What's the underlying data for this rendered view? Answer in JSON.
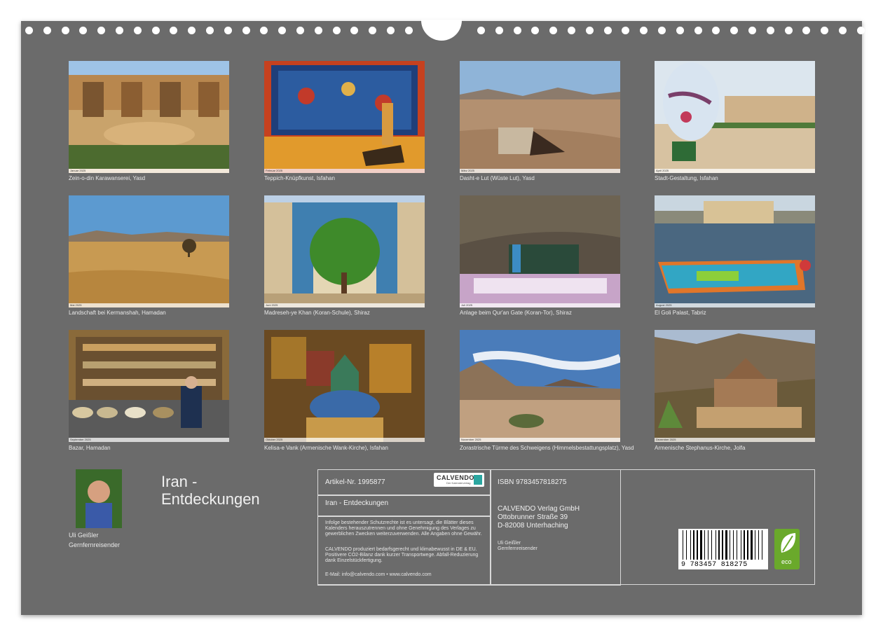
{
  "photos": [
    {
      "month": "Januar 2025",
      "caption": "Zein-o-din Karawanserei, Yasd"
    },
    {
      "month": "Februar 2025",
      "caption": "Teppich-Knüpfkunst, Isfahan"
    },
    {
      "month": "März 2025",
      "caption": "Dasht-e Lut (Wüste Lut), Yasd"
    },
    {
      "month": "April 2025",
      "caption": "Stadt-Gestaltung, Isfahan"
    },
    {
      "month": "Mai 2025",
      "caption": "Landschaft bei Kermanshah, Hamadan"
    },
    {
      "month": "Juni 2025",
      "caption": "Madreseh-ye Khan (Koran-Schule), Shiraz"
    },
    {
      "month": "Juli 2025",
      "caption": "Anlage beim Qur'an Gate (Koran-Tor), Shiraz"
    },
    {
      "month": "August 2025",
      "caption": "El Goli Palast, Tabriz"
    },
    {
      "month": "September 2025",
      "caption": "Bazar, Hamadan"
    },
    {
      "month": "Oktober 2025",
      "caption": "Kelisa-e Vank (Armenische Wank-Kirche), Isfahan"
    },
    {
      "month": "November 2025",
      "caption": "Zorastrische Türme des Schweigens (Himmelsbestattungsplatz), Yasd"
    },
    {
      "month": "Dezember 2025",
      "caption": "Armenische Stephanus-Kirche, Jolfa"
    }
  ],
  "author": {
    "name": "Uli Geißler",
    "role": "Gernfernreisender"
  },
  "title": {
    "line1": "Iran -",
    "line2": "Entdeckungen"
  },
  "info": {
    "article": "Artikel-Nr. 1995877",
    "calvendo_logo": "CALVENDO",
    "calvendo_tag": "Der Kalenderverlag",
    "book_title": "Iran - Entdeckungen",
    "legal1": "Infolge bestehender Schutzrechte ist es untersagt, die Blätter dieses Kalenders herauszutrennen und ohne Genehmigung des Verlages zu gewerblichen Zwecken weiterzuverwenden. Alle Angaben ohne Gewähr.",
    "legal2": "CALVENDO produziert bedarfsgerecht und klimabewusst in DE & EU. Positivere CO2-Bilanz dank kurzer Transportwege. Abfall-Reduzierung dank Einzelstückfertigung.",
    "contact": "E-Mail: info@calvendo.com • www.calvendo.com",
    "isbn": "ISBN 9783457818275",
    "publisher1": "CALVENDO Verlag GmbH",
    "publisher2": "Ottobrunner Straße 39",
    "publisher3": "D-82008 Unterhaching",
    "author_name": "Uli Geißler",
    "author_role": "Gernfernreisender",
    "barcode_digits": "9 783457 818275",
    "eco_label": "eco"
  },
  "colors": {
    "sheet": "#6b6b6b",
    "eco": "#6aa92b"
  }
}
